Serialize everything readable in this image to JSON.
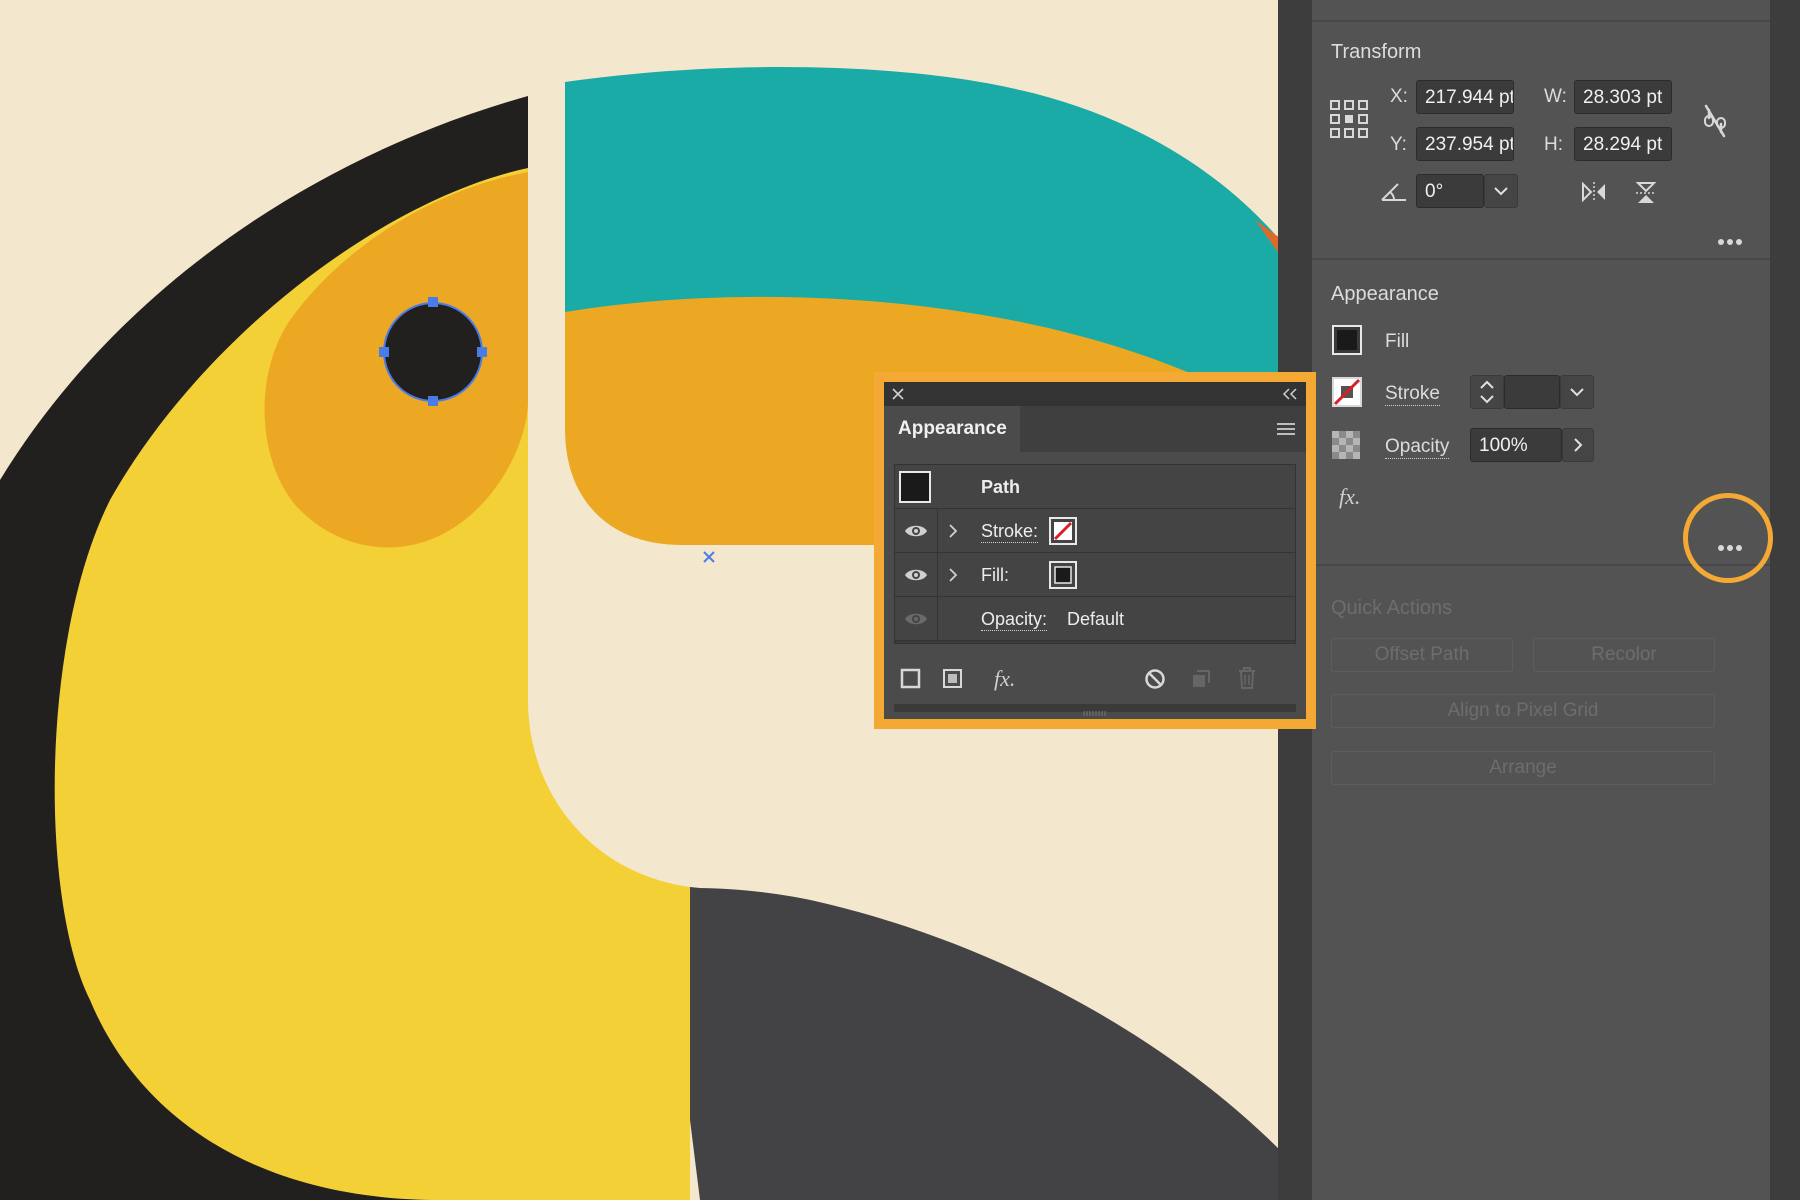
{
  "colors": {
    "canvas_bg": "#f3e7cd",
    "toucan_black": "#221f1f",
    "toucan_yellow": "#f4d037",
    "beak_orange": "#eca823",
    "beak_teal": "#1aaba6",
    "dark_body": "#434244",
    "selection_blue": "#4a7ce8",
    "highlight_orange": "#f4a935",
    "panel_bg": "#535353"
  },
  "transform": {
    "title": "Transform",
    "x_label": "X:",
    "x_value": "217.944 pt",
    "y_label": "Y:",
    "y_value": "237.954 pt",
    "w_label": "W:",
    "w_value": "28.303 pt",
    "h_label": "H:",
    "h_value": "28.294 pt",
    "angle_value": "0°"
  },
  "appearance_side": {
    "title": "Appearance",
    "fill_label": "Fill",
    "stroke_label": "Stroke",
    "stroke_value": "",
    "opacity_label": "Opacity",
    "opacity_value": "100%",
    "fx_label": "fx."
  },
  "quick_actions": {
    "title": "Quick Actions",
    "offset_path": "Offset Path",
    "recolor": "Recolor",
    "align_pixel": "Align to Pixel Grid",
    "arrange": "Arrange"
  },
  "appearance_panel": {
    "tab_label": "Appearance",
    "path_label": "Path",
    "stroke_label": "Stroke:",
    "fill_label": "Fill:",
    "opacity_label": "Opacity:",
    "opacity_value": "Default",
    "fx_label": "fx."
  }
}
